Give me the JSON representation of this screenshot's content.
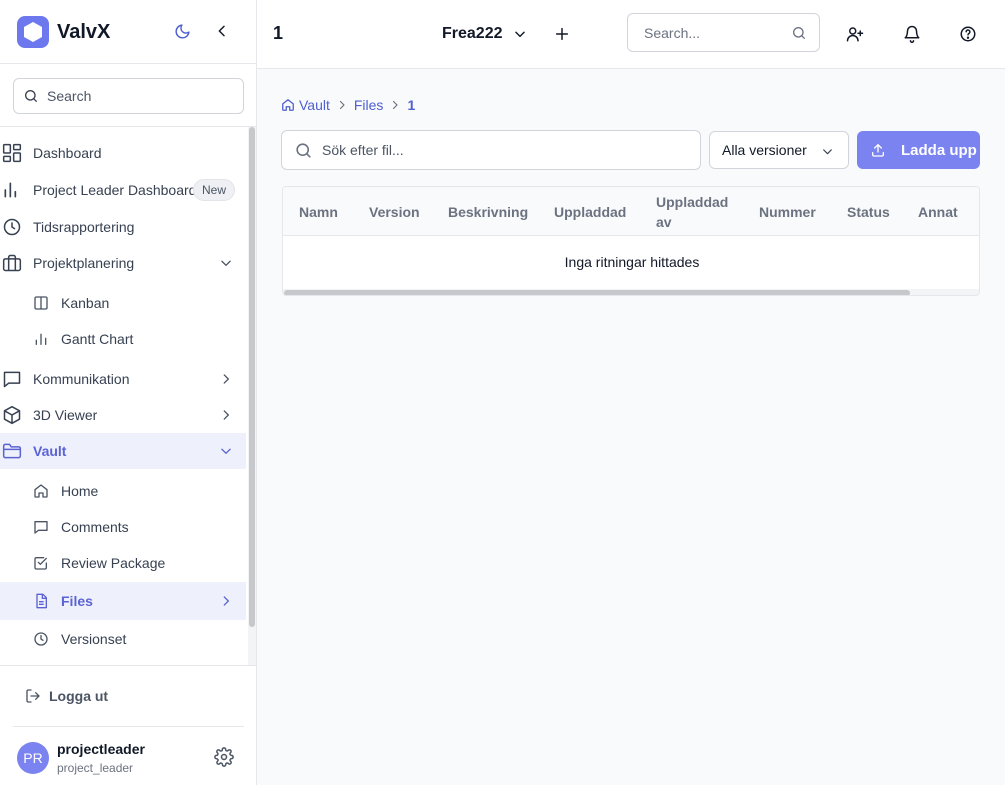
{
  "app": {
    "name": "ValvX",
    "accent": "#7b83f0"
  },
  "sidebar": {
    "search_placeholder": "Search",
    "items": [
      {
        "label": "Dashboard",
        "icon": "dashboard-icon"
      },
      {
        "label": "Project Leader Dashboard",
        "icon": "bar-chart-icon",
        "badge": "New"
      },
      {
        "label": "Tidsrapportering",
        "icon": "clock-icon"
      },
      {
        "label": "Projektplanering",
        "icon": "briefcase-icon",
        "expanded": true
      },
      {
        "label": "Kanban",
        "icon": "kanban-icon"
      },
      {
        "label": "Gantt Chart",
        "icon": "bar-chart-icon"
      },
      {
        "label": "Kommunikation",
        "icon": "message-icon"
      },
      {
        "label": "3D Viewer",
        "icon": "cube-icon"
      },
      {
        "label": "Vault",
        "icon": "folder-icon",
        "expanded": true,
        "active": true
      },
      {
        "label": "Home",
        "icon": "home-icon"
      },
      {
        "label": "Comments",
        "icon": "message-icon"
      },
      {
        "label": "Review Package",
        "icon": "checkbox-icon"
      },
      {
        "label": "Files",
        "icon": "file-icon",
        "active": true
      },
      {
        "label": "Versionset",
        "icon": "clock-icon"
      }
    ],
    "logout_label": "Logga ut",
    "user": {
      "initials": "PR",
      "name": "projectleader",
      "role": "project_leader"
    }
  },
  "header": {
    "title": "1",
    "project": "Frea222",
    "search_placeholder": "Search..."
  },
  "breadcrumb": {
    "items": [
      "Vault",
      "Files",
      "1"
    ]
  },
  "toolbar": {
    "file_search_placeholder": "Sök efter fil...",
    "version_filter": "Alla versioner",
    "upload_label": "Ladda upp"
  },
  "table": {
    "columns": [
      "Namn",
      "Version",
      "Beskrivning",
      "Uppladdad",
      "Uppladdad av",
      "Nummer",
      "Status",
      "Annat"
    ],
    "empty_message": "Inga ritningar hittades",
    "horizontal_scroll_fraction": 0.9
  }
}
